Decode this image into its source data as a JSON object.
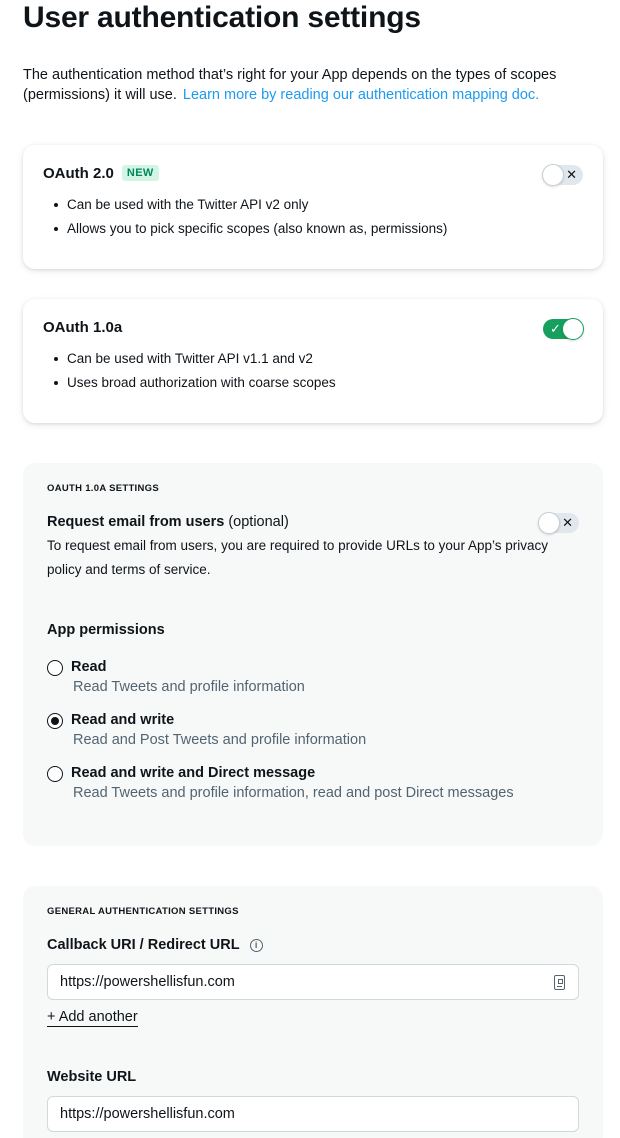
{
  "page": {
    "title": "User authentication settings",
    "intro_text": "The authentication method that’s right for your App depends on the types of scopes (permissions) it will use.",
    "intro_link": "Learn more by reading our authentication mapping doc."
  },
  "oauth2": {
    "title": "OAuth 2.0",
    "badge": "NEW",
    "enabled": false,
    "toggle_mark": "✕",
    "bullets": [
      "Can be used with the Twitter API v2 only",
      "Allows you to pick specific scopes (also known as, permissions)"
    ]
  },
  "oauth1": {
    "title": "OAuth 1.0a",
    "enabled": true,
    "toggle_mark": "✓",
    "bullets": [
      "Can be used with Twitter API v1.1 and v2",
      "Uses broad authorization with coarse scopes"
    ]
  },
  "oauth1_settings": {
    "section_label": "OAUTH 1.0A SETTINGS",
    "email_label": "Request email from users",
    "email_optional": "(optional)",
    "email_enabled": false,
    "email_toggle_mark": "✕",
    "email_help": "To request email from users, you are required to provide URLs to your App’s privacy policy and terms of service.",
    "permissions_label": "App permissions",
    "permissions": [
      {
        "label": "Read",
        "desc": "Read Tweets and profile information",
        "selected": false
      },
      {
        "label": "Read and write",
        "desc": "Read and Post Tweets and profile information",
        "selected": true
      },
      {
        "label": "Read and write and Direct message",
        "desc": "Read Tweets and profile information, read and post Direct messages",
        "selected": false
      }
    ]
  },
  "general_settings": {
    "section_label": "GENERAL AUTHENTICATION SETTINGS",
    "callback_label": "Callback URI / Redirect URL",
    "info_icon": "i",
    "callback_value": "https://powershellisfun.com",
    "add_another": "+ Add another",
    "website_label": "Website URL",
    "website_value": "https://powershellisfun.com"
  },
  "colors": {
    "link": "#1d9bf0",
    "toggle_on": "#17a05d",
    "badge_bg": "#d3f5e6",
    "badge_text": "#00875a",
    "panel_bg": "#f7f9f9"
  }
}
